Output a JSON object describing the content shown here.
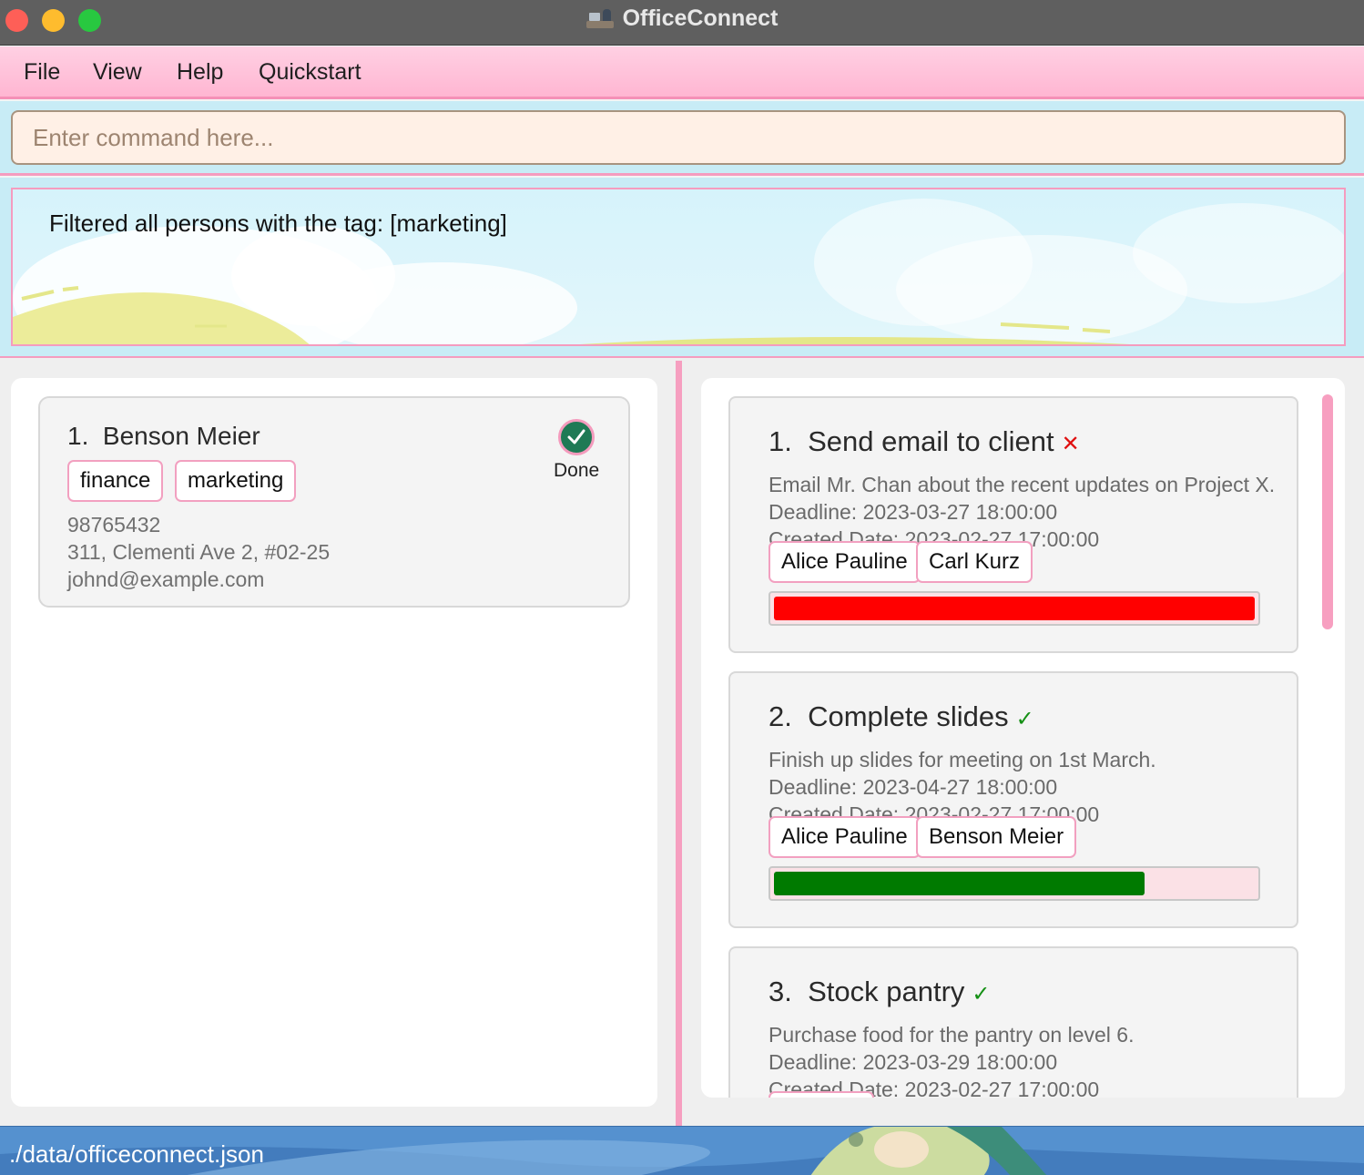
{
  "window": {
    "title": "OfficeConnect"
  },
  "menu": {
    "items": [
      "File",
      "View",
      "Help",
      "Quickstart"
    ]
  },
  "command": {
    "placeholder": "Enter command here...",
    "value": ""
  },
  "result": {
    "message": "Filtered all persons with the tag: [marketing]"
  },
  "persons": [
    {
      "index": "1.",
      "name": "Benson Meier",
      "tags": [
        "finance",
        "marketing"
      ],
      "phone": "98765432",
      "address": "311, Clementi Ave 2, #02-25",
      "email": "johnd@example.com",
      "status_label": "Done",
      "status_icon": "check-circle-icon"
    }
  ],
  "tasks": [
    {
      "index": "1.",
      "title": "Send email to client",
      "status_symbol": "✕",
      "status": "not-done",
      "description": "Email Mr. Chan about the recent updates on Project X.",
      "deadline": "Deadline: 2023-03-27 18:00:00",
      "created": "Created Date: 2023-02-27 17:00:00",
      "assignees": [
        "Alice Pauline",
        "Carl Kurz"
      ],
      "progress": 1.0,
      "progress_color": "#ff0000"
    },
    {
      "index": "2.",
      "title": "Complete slides",
      "status_symbol": "✓",
      "status": "done",
      "description": "Finish up slides for meeting on 1st March.",
      "deadline": "Deadline: 2023-04-27 18:00:00",
      "created": "Created Date: 2023-02-27 17:00:00",
      "assignees": [
        "Alice Pauline",
        "Benson Meier"
      ],
      "progress": 0.77,
      "progress_color": "#007a00"
    },
    {
      "index": "3.",
      "title": "Stock pantry",
      "status_symbol": "✓",
      "status": "done",
      "description": "Purchase food for the pantry on level 6.",
      "deadline": "Deadline: 2023-03-29 18:00:00",
      "created": "Created Date: 2023-02-27 17:00:00",
      "assignees": [],
      "progress": null,
      "progress_color": ""
    }
  ],
  "status_bar": {
    "path": "./data/officeconnect.json"
  },
  "colors": {
    "accent_pink": "#f69fc0",
    "menu_bg": "#ffc3dc",
    "command_bg": "#c8ecf6",
    "task_overdue": "#ff0000",
    "task_progress": "#007a00"
  }
}
